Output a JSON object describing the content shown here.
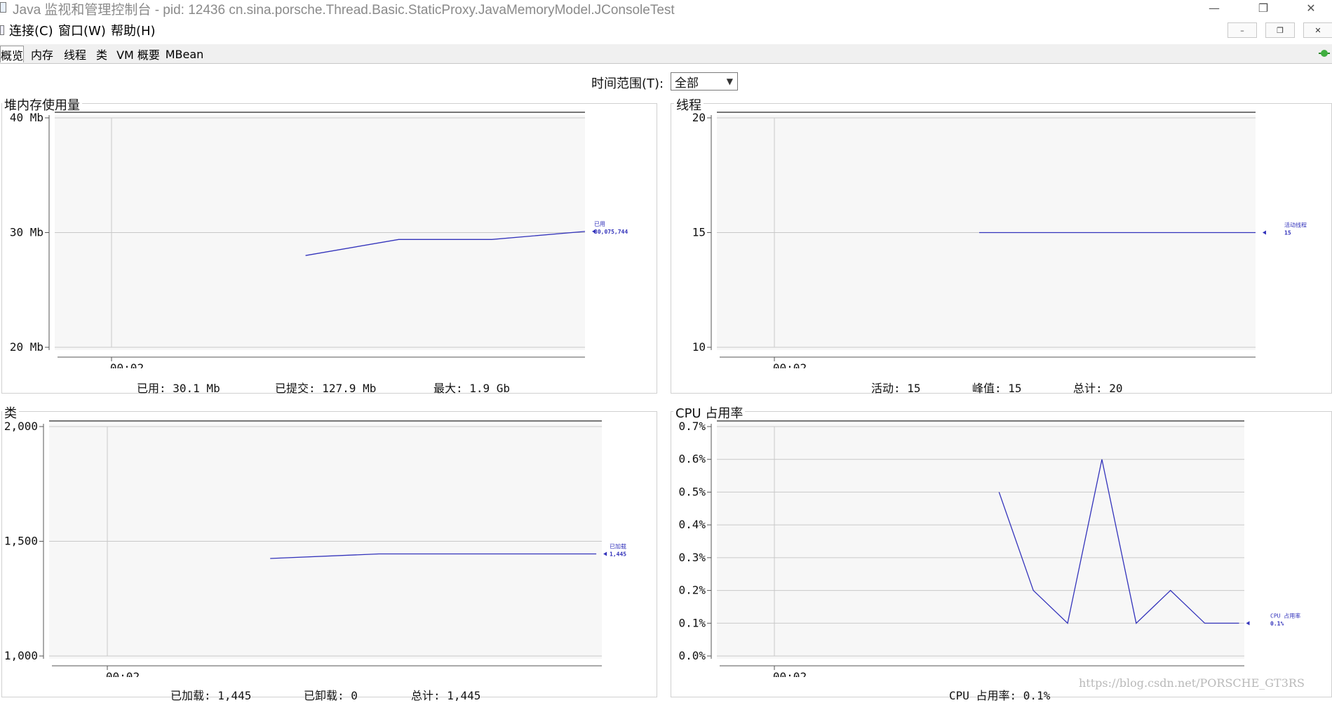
{
  "window": {
    "title": "Java 监视和管理控制台 - pid: 12436 cn.sina.porsche.Thread.Basic.StaticProxy.JavaMemoryModel.JConsoleTest",
    "controls": {
      "minimize": "—",
      "maximize": "❐",
      "close": "✕"
    }
  },
  "menu": {
    "items": [
      "连接(C)",
      "窗口(W)",
      "帮助(H)"
    ],
    "mdi_buttons": [
      "–",
      "❐",
      "✕"
    ]
  },
  "tabs": [
    "概览",
    "内存",
    "线程",
    "类",
    "VM 概要",
    "MBean"
  ],
  "time_range": {
    "label": "时间范围(T):",
    "value": "全部"
  },
  "panels": {
    "heap": {
      "title": "堆内存使用量",
      "stats": {
        "used": "已用: 30.1 Mb",
        "committed": "已提交: 127.9 Mb",
        "max": "最大: 1.9 Gb"
      }
    },
    "threads": {
      "title": "线程",
      "stats": {
        "active": "活动: 15",
        "peak": "峰值: 15",
        "total": "总计: 20"
      }
    },
    "classes": {
      "title": "类",
      "stats": {
        "loaded": "已加载: 1,445",
        "unloaded": "已卸载: 0",
        "total": "总计: 1,445"
      }
    },
    "cpu": {
      "title": "CPU 占用率",
      "stats": {
        "usage": "CPU 占用率: 0.1%"
      }
    }
  },
  "chart_data": [
    {
      "type": "line",
      "title": "堆内存使用量",
      "x_tick_labels": [
        "00:02"
      ],
      "y_tick_labels": [
        "40 Mb",
        "30 Mb",
        "20 Mb"
      ],
      "ylim": [
        20,
        40
      ],
      "grid": true,
      "series": [
        {
          "name": "已用",
          "current_label": "30,075,744",
          "values": [
            28.0,
            29.4,
            29.4,
            30.1
          ]
        }
      ]
    },
    {
      "type": "line",
      "title": "线程",
      "x_tick_labels": [
        "00:02"
      ],
      "y_tick_labels": [
        "20",
        "15",
        "10"
      ],
      "ylim": [
        10,
        20
      ],
      "grid": true,
      "series": [
        {
          "name": "活动线程",
          "current_label": "15",
          "values": [
            15,
            15
          ]
        }
      ]
    },
    {
      "type": "line",
      "title": "类",
      "x_tick_labels": [
        "00:02"
      ],
      "y_tick_labels": [
        "2,000",
        "1,500",
        "1,000"
      ],
      "ylim": [
        1000,
        2000
      ],
      "grid": true,
      "series": [
        {
          "name": "已加载",
          "current_label": "1,445",
          "values": [
            1425,
            1445,
            1445,
            1445
          ]
        }
      ]
    },
    {
      "type": "line",
      "title": "CPU 占用率",
      "x_tick_labels": [
        "00:02"
      ],
      "y_tick_labels": [
        "0.7%",
        "0.6%",
        "0.5%",
        "0.4%",
        "0.3%",
        "0.2%",
        "0.1%",
        "0.0%"
      ],
      "ylim": [
        0,
        0.7
      ],
      "grid": true,
      "series": [
        {
          "name": "CPU 占用率",
          "current_label": "0.1%",
          "values": [
            0.5,
            0.2,
            0.1,
            0.6,
            0.1,
            0.2,
            0.1,
            0.1
          ]
        }
      ]
    }
  ],
  "colors": {
    "line": "#3333bb",
    "grid": "#c8c8c8",
    "plot_bg": "#f7f7f7",
    "axis": "#555555"
  },
  "watermark": "https://blog.csdn.net/PORSCHE_GT3RS"
}
